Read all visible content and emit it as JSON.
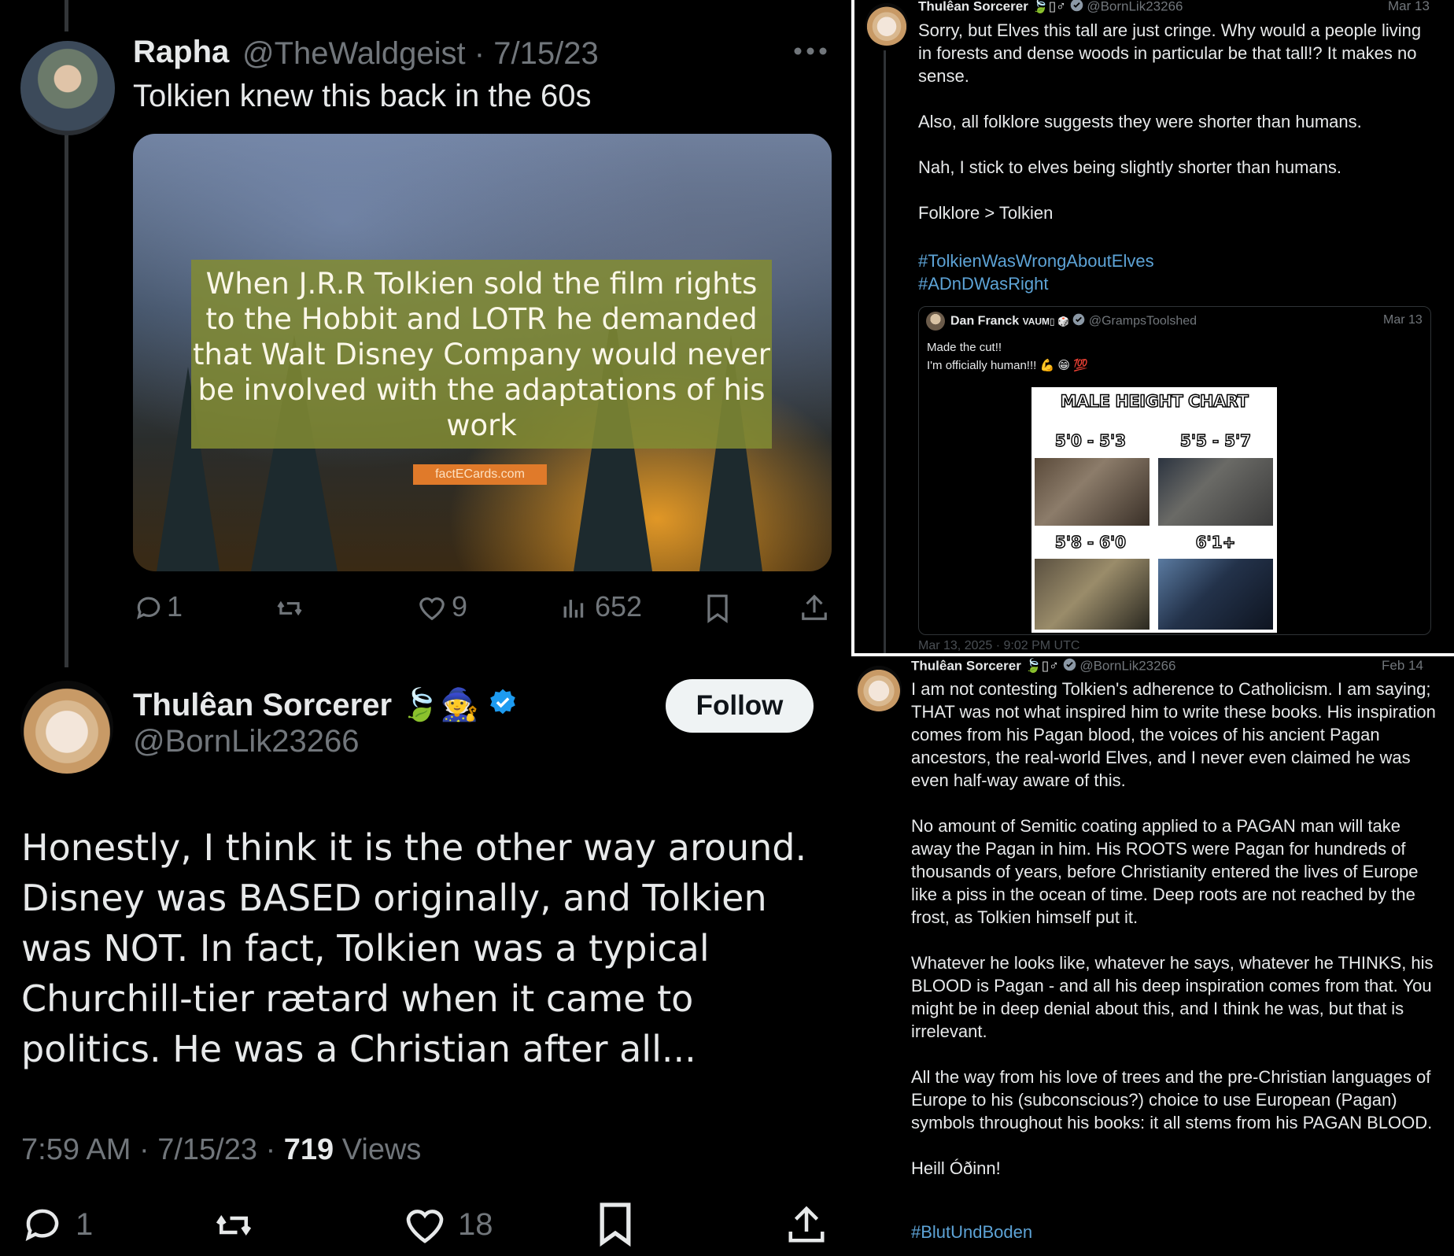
{
  "left": {
    "parent": {
      "display_name": "Rapha",
      "handle": "@TheWaldgeist",
      "dot": "·",
      "date": "7/15/23",
      "text": "Tolkien knew this back in the 60s",
      "image_text": "When J.R.R Tolkien sold the film rights to the Hobbit and LOTR he demanded that Walt Disney Company would never be involved with the adaptations of his work",
      "image_tag": "factECards.com",
      "replies": "1",
      "likes": "9",
      "views": "652"
    },
    "reply": {
      "display_name": "Thulêan Sorcerer",
      "emoji": "🍃🧙",
      "handle": "@BornLik23266",
      "follow_label": "Follow",
      "text": "Honestly, I think it is the other way around. Disney was BASED originally, and Tolkien was NOT. In fact, Tolkien was a typical Churchill-tier rætard when it came to politics. He was a Christian after all...",
      "time": "7:59 AM",
      "dot": "·",
      "date": "7/15/23",
      "view_count": "719",
      "views_label": "Views",
      "replies": "1",
      "likes": "18"
    }
  },
  "top_right": {
    "display_name": "Thulêan Sorcerer",
    "marks": "🍃▯♂",
    "handle": "@BornLik23266",
    "date": "Mar 13",
    "text": "Sorry, but Elves this tall are just cringe. Why would a people living in forests and dense woods in particular be that tall!? It makes no sense.\n\nAlso, all folklore suggests they were shorter than humans.\n\nNah, I stick to elves being slightly shorter than humans.\n\nFolklore > Tolkien",
    "hashtags": [
      "#TolkienWasWrongAboutElves",
      "#ADnDWasRight"
    ],
    "quote": {
      "display_name": "Dan Franck",
      "badge": "VAUM▯ 🎲",
      "handle": "@GrampsToolshed",
      "date": "Mar 13",
      "line1": "Made the cut!!",
      "line2": "I'm officially human!!! 💪 😁 💯",
      "chart_title": "MALE HEIGHT CHART",
      "labels": [
        "5'0 - 5'3",
        "5'5 - 5'7",
        "5'8 - 6'0",
        "6'1+"
      ]
    },
    "footer": "Mar 13, 2025 · 9:02 PM UTC"
  },
  "bottom_right": {
    "display_name": "Thulêan Sorcerer",
    "marks": "🍃▯♂",
    "handle": "@BornLik23266",
    "date": "Feb 14",
    "text": "I am not contesting Tolkien's adherence to Catholicism. I am saying; THAT was not what inspired him to write these books. His inspiration comes from his Pagan blood, the voices of his ancient Pagan ancestors, the real-world Elves, and I never even claimed he was even half-way aware of this.\n\nNo amount of Semitic coating applied to a PAGAN man will take away the Pagan in him. His ROOTS were Pagan for hundreds of thousands of years, before Christianity entered the lives of Europe like a piss in the ocean of time. Deep roots are not reached by the frost, as Tolkien himself put it.\n\nWhatever he looks like, whatever he says, whatever he THINKS, his BLOOD is Pagan - and all his deep inspiration comes from that. You might be in deep denial about this, and I think he was, but that is irrelevant.\n\nAll the way from his love of trees and the pre-Christian languages of Europe to his (subconscious?) choice to use European (Pagan) symbols throughout his books: it all stems from his PAGAN BLOOD.\n\nHeill Óðinn!",
    "hashtag": "#BlutUndBoden"
  },
  "colors": {
    "background": "#000000",
    "text": "#e7e9ea",
    "muted": "#71767b",
    "verified": "#1d9bf0",
    "hashtag": "#5da3d6"
  }
}
